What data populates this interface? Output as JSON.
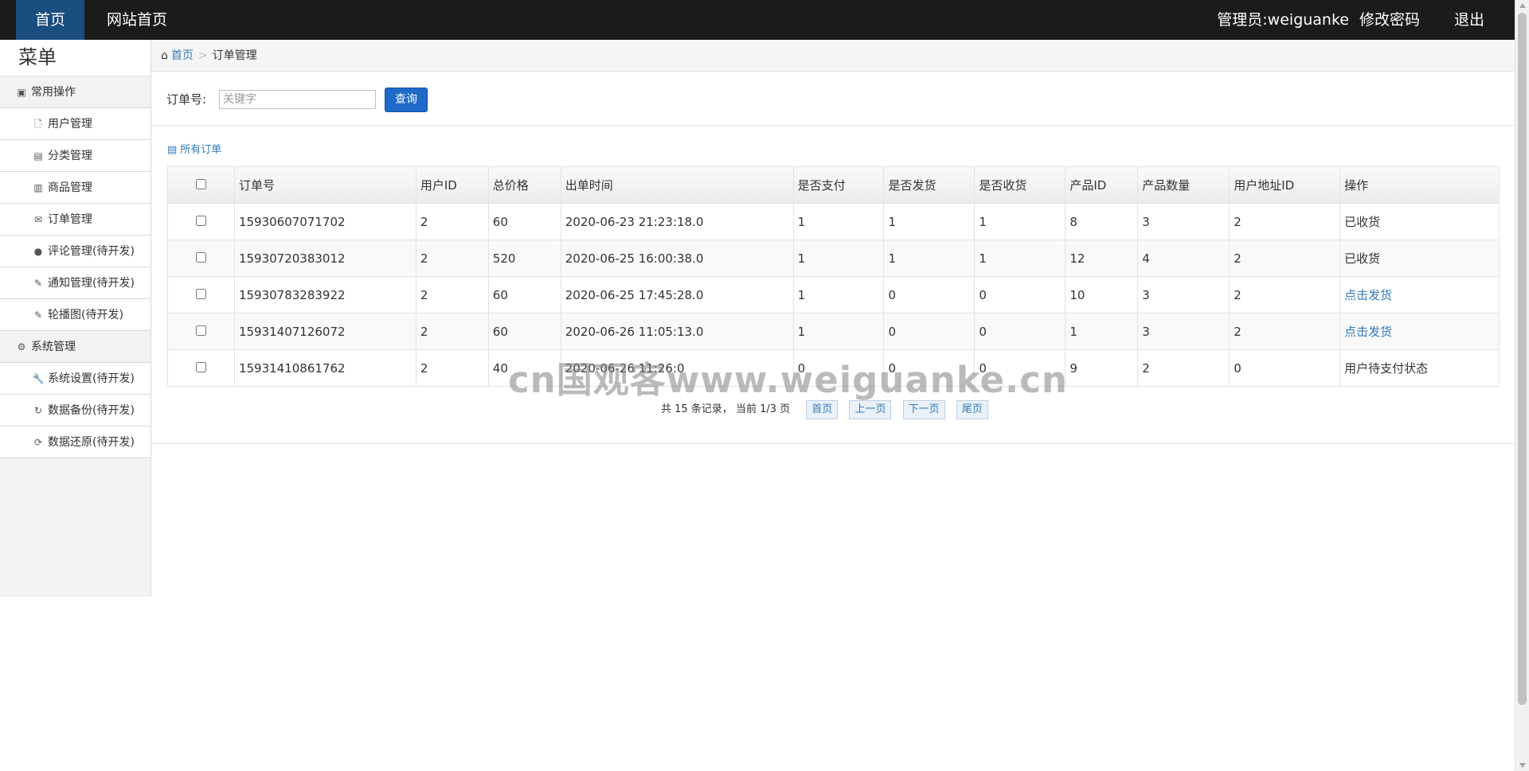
{
  "topbar": {
    "home": "首页",
    "site_home": "网站首页",
    "admin": "管理员:weiguanke",
    "change_password": "修改密码",
    "logout": "退出"
  },
  "sidebar": {
    "title": "菜单",
    "group_common": "常用操作",
    "items_common": [
      "用户管理",
      "分类管理",
      "商品管理",
      "订单管理",
      "评论管理(待开发)",
      "通知管理(待开发)",
      "轮播图(待开发)"
    ],
    "group_system": "系统管理",
    "items_system": [
      "系统设置(待开发)",
      "数据备份(待开发)",
      "数据还原(待开发)"
    ]
  },
  "breadcrumb": {
    "home": "首页",
    "separator": ">",
    "current": "订单管理"
  },
  "search": {
    "label": "订单号:",
    "placeholder": "关键字",
    "button": "查询"
  },
  "panel": {
    "title": "所有订单"
  },
  "table": {
    "headers": [
      "订单号",
      "用户ID",
      "总价格",
      "出单时间",
      "是否支付",
      "是否发货",
      "是否收货",
      "产品ID",
      "产品数量",
      "用户地址ID",
      "操作"
    ],
    "rows": [
      [
        "15930607071702",
        "2",
        "60",
        "2020-06-23 21:23:18.0",
        "1",
        "1",
        "1",
        "8",
        "3",
        "2",
        "已收货"
      ],
      [
        "15930720383012",
        "2",
        "520",
        "2020-06-25 16:00:38.0",
        "1",
        "1",
        "1",
        "12",
        "4",
        "2",
        "已收货"
      ],
      [
        "15930783283922",
        "2",
        "60",
        "2020-06-25 17:45:28.0",
        "1",
        "0",
        "0",
        "10",
        "3",
        "2",
        "点击发货"
      ],
      [
        "15931407126072",
        "2",
        "60",
        "2020-06-26 11:05:13.0",
        "1",
        "0",
        "0",
        "1",
        "3",
        "2",
        "点击发货"
      ],
      [
        "15931410861762",
        "2",
        "40",
        "2020-06-26 11:26:0",
        "0",
        "0",
        "0",
        "9",
        "2",
        "0",
        "用户待支付状态"
      ]
    ]
  },
  "pagination": {
    "info": "共 15 条记录，  当前 1/3 页",
    "first": "首页",
    "prev": "上一页",
    "next": "下一页",
    "last": "尾页"
  },
  "watermark": "cn国观客www.weiguanke.cn",
  "colors": {
    "topbar_bg": "#1b1b1b",
    "topbar_active": "#1a4d80",
    "link": "#337ab7",
    "button": "#1f69c9"
  }
}
